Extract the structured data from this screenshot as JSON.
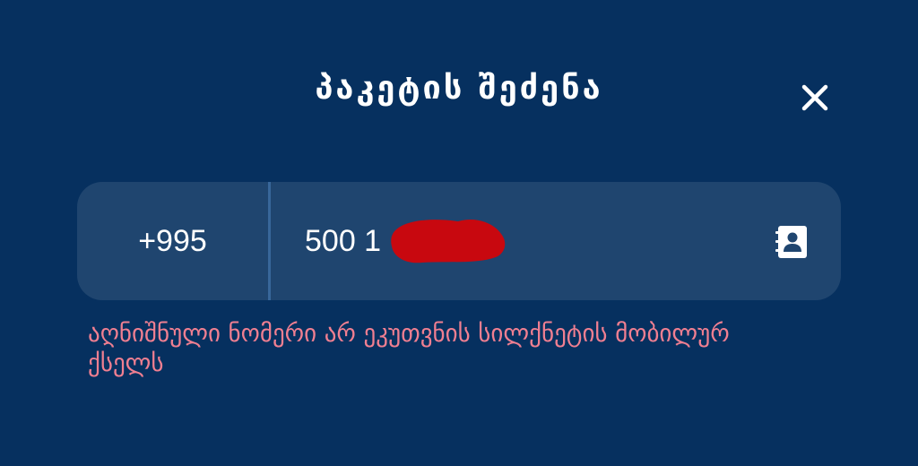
{
  "dialog": {
    "title": "პაკეტის შეძენა",
    "close_icon": "close-icon"
  },
  "phone": {
    "country_code": "+995",
    "value": "500 1",
    "contacts_icon": "contact-book-icon"
  },
  "error": {
    "message": "აღნიშნული ნომერი არ ეკუთვნის სილქნეტის მობილურ ქსელს"
  },
  "colors": {
    "background": "#06305f",
    "field": "#1f456f",
    "error": "#f07f91",
    "redaction": "#c8080f"
  }
}
